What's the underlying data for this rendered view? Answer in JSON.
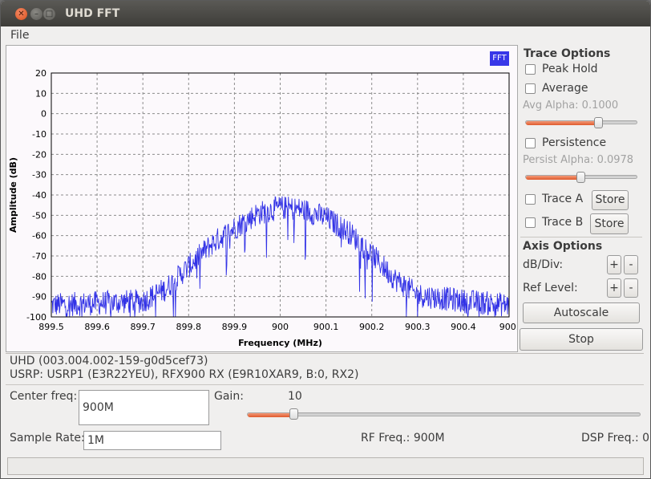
{
  "window": {
    "title": "UHD FFT"
  },
  "menu": {
    "file": "File"
  },
  "plot": {
    "badge": "FFT",
    "colors": {
      "trace": "#3232e6",
      "grid": "#8c8c8c",
      "badge": "#3838e8"
    }
  },
  "chart_data": {
    "type": "line",
    "xlabel": "Frequency (MHz)",
    "ylabel": "Amplitude (dB)",
    "xlim": [
      899.5,
      900.5
    ],
    "ylim": [
      -100,
      20
    ],
    "x_ticks": [
      "899.5",
      "899.6",
      "899.7",
      "899.8",
      "899.9",
      "900",
      "900.1",
      "900.2",
      "900.3",
      "900.4",
      "900."
    ],
    "y_ticks": [
      "20",
      "10",
      "0",
      "-10",
      "-20",
      "-30",
      "-40",
      "-50",
      "-60",
      "-70",
      "-80",
      "-90",
      "-100"
    ],
    "grid": true,
    "series": [
      {
        "envelope_x": [
          899.5,
          899.6,
          899.7,
          899.75,
          899.8,
          899.85,
          899.9,
          899.95,
          900.0,
          900.05,
          900.1,
          900.15,
          900.2,
          900.25,
          900.3,
          900.4,
          900.5
        ],
        "envelope_y": [
          -93,
          -92,
          -91,
          -85,
          -74,
          -63,
          -55,
          -48,
          -45,
          -46,
          -50,
          -57,
          -68,
          -80,
          -88,
          -91,
          -93
        ]
      }
    ]
  },
  "trace_options": {
    "title": "Trace Options",
    "peak_hold": "Peak Hold",
    "average": "Average",
    "avg_alpha": "Avg Alpha: 0.1000",
    "avg_alpha_value": 0.1,
    "persistence": "Persistence",
    "persist_alpha": "Persist Alpha: 0.0978",
    "persist_alpha_value": 0.0978,
    "trace_a": "Trace A",
    "trace_b": "Trace B",
    "store": "Store"
  },
  "axis_options": {
    "title": "Axis Options",
    "db_div": "dB/Div:",
    "ref_level": "Ref Level:",
    "plus": "+",
    "minus": "-",
    "autoscale": "Autoscale"
  },
  "stop_label": "Stop",
  "status": {
    "line1": "UHD (003.004.002-159-g0d5cef73)",
    "line2": "USRP: USRP1 (E3R22YEU), RFX900 RX (E9R10XAR9, B:0, RX2)"
  },
  "controls": {
    "center_freq_label": "Center freq:",
    "center_freq_value": "900M",
    "gain_label": "Gain:",
    "gain_value": "10",
    "gain_fraction": 0.12,
    "sample_rate_label": "Sample Rate:",
    "sample_rate_value": "1M",
    "rf_freq": "RF Freq.: 900M",
    "dsp_freq": "DSP Freq.: 0"
  }
}
